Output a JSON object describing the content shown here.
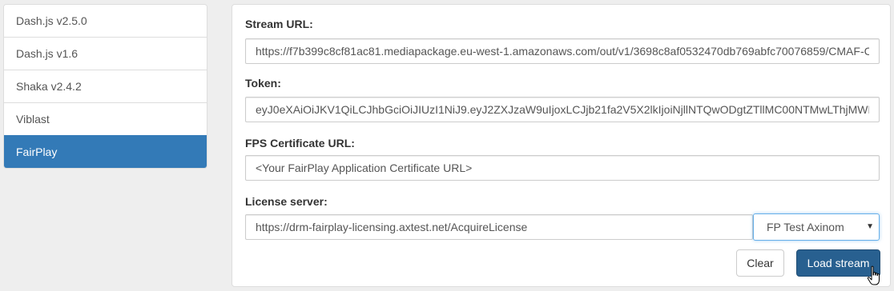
{
  "sidebar": {
    "items": [
      {
        "label": "Dash.js v2.5.0"
      },
      {
        "label": "Dash.js v1.6"
      },
      {
        "label": "Shaka v2.4.2"
      },
      {
        "label": "Viblast"
      },
      {
        "label": "FairPlay"
      }
    ],
    "active_index": 4
  },
  "form": {
    "stream_url": {
      "label": "Stream URL:",
      "value": "https://f7b399c8cf81ac81.mediapackage.eu-west-1.amazonaws.com/out/v1/3698c8af0532470db769abfc70076859/CMAF-C"
    },
    "token": {
      "label": "Token:",
      "value": "eyJ0eXAiOiJKV1QiLCJhbGciOiJIUzI1NiJ9.eyJ2ZXJzaW9uIjoxLCJjb21fa2V5X2lkIjoiNjllNTQwODgtZTllMC00NTMwLThjMWE"
    },
    "fps_certificate": {
      "label": "FPS Certificate URL:",
      "placeholder": "<Your FairPlay Application Certificate URL>"
    },
    "license_server": {
      "label": "License server:",
      "value": "https://drm-fairplay-licensing.axtest.net/AcquireLicense",
      "selected_option": "FP Test Axinom"
    }
  },
  "buttons": {
    "clear_label": "Clear",
    "load_label": "Load stream"
  },
  "colors": {
    "accent": "#337ab7",
    "primary_button": "#286090"
  }
}
